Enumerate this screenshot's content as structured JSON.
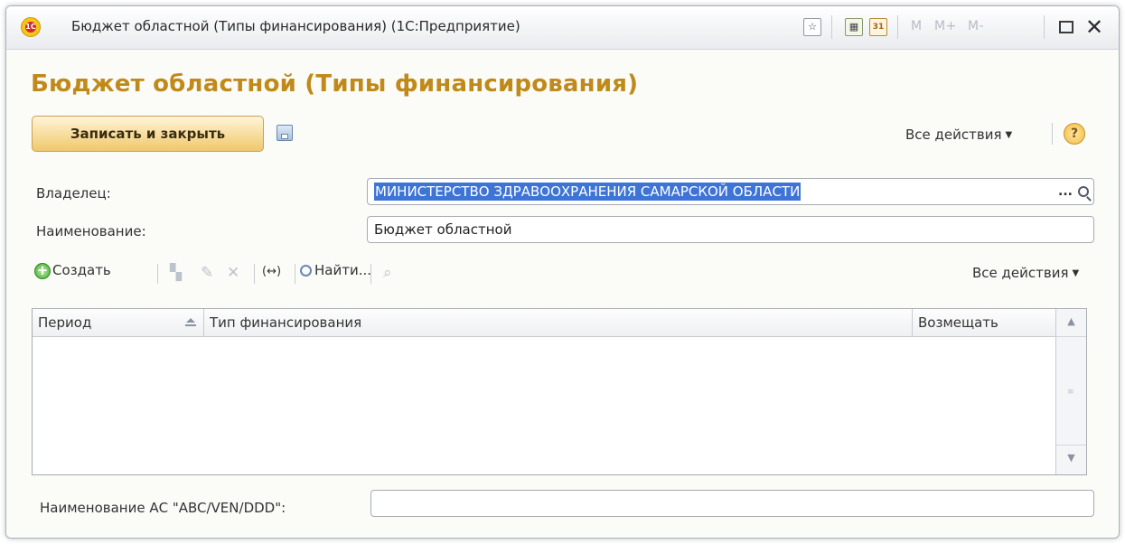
{
  "window": {
    "title": "Бюджет областной (Типы финансирования) (1С:Предприятие)",
    "logo_text": "1С",
    "mem_buttons": [
      "M",
      "M+",
      "M-"
    ]
  },
  "form": {
    "title": "Бюджет областной (Типы финансирования)",
    "save_close_label": "Записать и закрыть",
    "all_actions_label": "Все действия",
    "help_label": "?"
  },
  "fields": {
    "owner_label": "Владелец:",
    "owner_value": "МИНИСТЕРСТВО ЗДРАВООХРАНЕНИЯ САМАРСКОЙ ОБЛАСТИ",
    "owner_select_label": "...",
    "name_label": "Наименование:",
    "name_value": "Бюджет областной",
    "abc_label": "Наименование АС \"ABC/VEN/DDD\":",
    "abc_value": ""
  },
  "table_toolbar": {
    "create_label": "Создать",
    "link_label": "(↔)",
    "find_label": "Найти...",
    "all_actions_label": "Все действия"
  },
  "table": {
    "columns": [
      "Период",
      "Тип финансирования",
      "Возмещать"
    ],
    "rows": []
  },
  "colors": {
    "title_accent": "#c08a1b",
    "selection": "#3d74d6",
    "primary_button": "#f7dc9b"
  }
}
